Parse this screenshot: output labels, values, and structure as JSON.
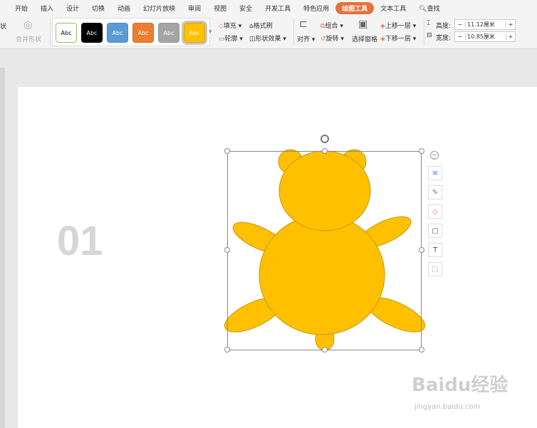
{
  "tabs": [
    "开始",
    "插入",
    "设计",
    "切换",
    "动画",
    "幻灯片放映",
    "审阅",
    "视图",
    "安全",
    "开发工具",
    "特色应用",
    "绘图工具",
    "文本工具",
    "查找"
  ],
  "ribbon": {
    "left_partial_1": "状",
    "merge_shapes": "合并形状",
    "styles": [
      {
        "label": "Abc",
        "bg": "#ffffff",
        "fg": "#000000",
        "border": "#8cc06a"
      },
      {
        "label": "Abc",
        "bg": "#000000",
        "fg": "#ffffff",
        "border": "#000000"
      },
      {
        "label": "Abc",
        "bg": "#5b9bd5",
        "fg": "#ffffff",
        "border": "#4a89c4"
      },
      {
        "label": "Abc",
        "bg": "#ed7d31",
        "fg": "#ffffff",
        "border": "#d56b20"
      },
      {
        "label": "Abc",
        "bg": "#a5a5a5",
        "fg": "#ffffff",
        "border": "#939393"
      },
      {
        "label": "Abc",
        "bg": "#ffc000",
        "fg": "#ffffff",
        "border": "#d9a300"
      }
    ],
    "fill": "填充",
    "outline": "轮廓",
    "format_painter": "格式刷",
    "shape_effects": "形状效果",
    "align": "对齐",
    "group": "组合",
    "rotate": "旋转",
    "selection_pane": "选择窗格",
    "bring_forward": "上移一层",
    "send_backward": "下移一层",
    "height_label": "高度:",
    "height_value": "11.12厘米",
    "width_label": "宽度:",
    "width_value": "10.85厘米"
  },
  "slide": {
    "number": "01",
    "shape_fill": "#FFC000",
    "shape_stroke": "#C89600"
  },
  "watermark": {
    "text": "Baidu经验",
    "url": "jingyan.baidu.com"
  }
}
